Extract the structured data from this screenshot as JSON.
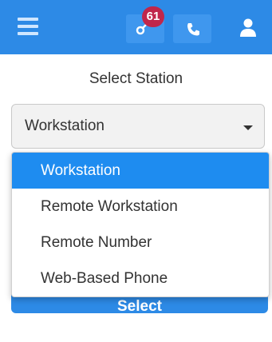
{
  "header": {
    "menu_icon": "hamburger-icon",
    "notifications_icon": "link-icon",
    "notification_count": "61",
    "phone_icon": "phone-icon",
    "user_icon": "user-icon",
    "colors": {
      "bar": "#2d8ae6",
      "button": "#3f97ee",
      "badge": "#c0264b"
    }
  },
  "station": {
    "title": "Select Station",
    "selected": "Workstation",
    "options": [
      "Workstation",
      "Remote Workstation",
      "Remote Number",
      "Web-Based Phone"
    ],
    "select_button": "Select",
    "colors": {
      "highlight": "#1e8cf0"
    }
  }
}
